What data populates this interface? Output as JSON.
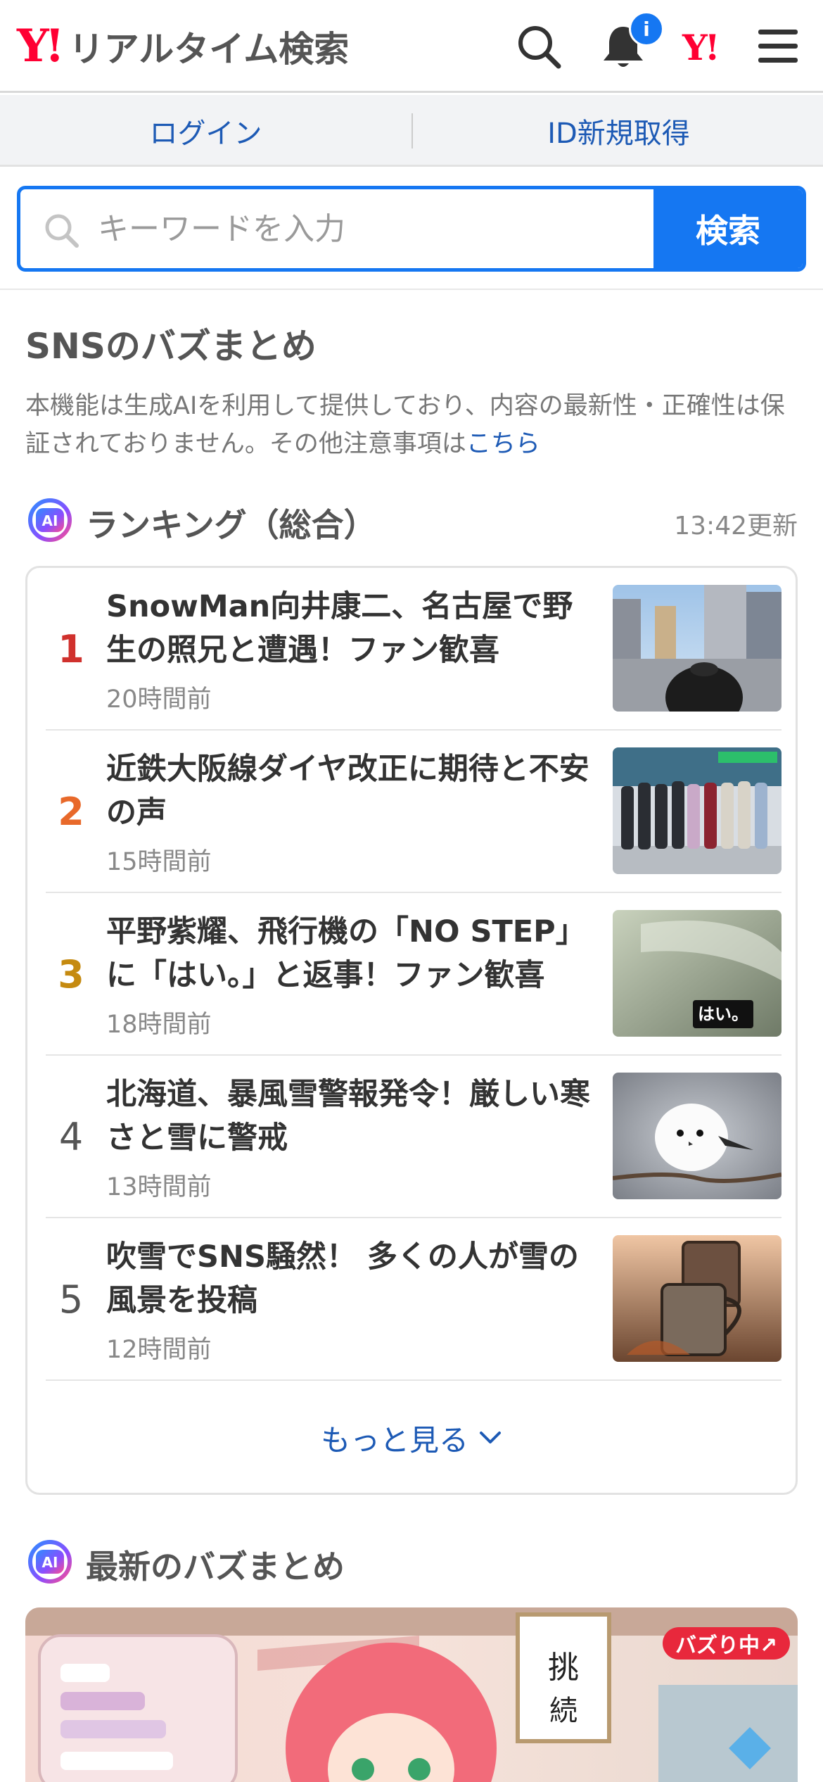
{
  "header": {
    "logo_mark": "Y!",
    "logo_text": "リアルタイム検索",
    "notification_badge": "i",
    "yahoo_mark": "Y!"
  },
  "login_bar": {
    "login_label": "ログイン",
    "register_label": "ID新規取得"
  },
  "search": {
    "placeholder": "キーワードを入力",
    "button_label": "検索"
  },
  "section": {
    "title": "SNSのバズまとめ",
    "notice_text": "本機能は生成AIを利用して提供しており、内容の最新性・正確性は保証されておりません。その他注意事項は",
    "notice_link": "こちら"
  },
  "ranking": {
    "ai_badge": "AI",
    "heading": "ランキング（総合）",
    "updated": "13:42更新",
    "items": [
      {
        "rank": "1",
        "title": "SnowMan向井康二、名古屋で野生の照兄と遭遇！ファン歓喜",
        "time": "20時間前",
        "rank_color": "#d0312d"
      },
      {
        "rank": "2",
        "title": "近鉄大阪線ダイヤ改正に期待と不安の声",
        "time": "15時間前",
        "rank_color": "#e8692a"
      },
      {
        "rank": "3",
        "title": "平野紫耀、飛行機の「NO STEP」に「はい。」と返事！ファン歓喜",
        "time": "18時間前",
        "rank_color": "#c58a10"
      },
      {
        "rank": "4",
        "title": "北海道、暴風雪警報発令！厳しい寒さと雪に警戒",
        "time": "13時間前",
        "rank_color": "#555555"
      },
      {
        "rank": "5",
        "title": "吹雪でSNS騒然！ 多くの人が雪の風景を投稿",
        "time": "12時間前",
        "rank_color": "#555555"
      }
    ],
    "thumb3_caption": "はい。",
    "more_label": "もっと見る"
  },
  "latest": {
    "ai_badge": "AI",
    "heading": "最新のバズまとめ",
    "buzz_badge": "バズり中↗"
  },
  "colors": {
    "brand_red": "#ff0033",
    "accent_blue": "#1577f2",
    "link_blue": "#1d5ab5"
  },
  "icons": [
    "search-icon",
    "bell-icon",
    "menu-icon",
    "chevron-down-icon"
  ]
}
